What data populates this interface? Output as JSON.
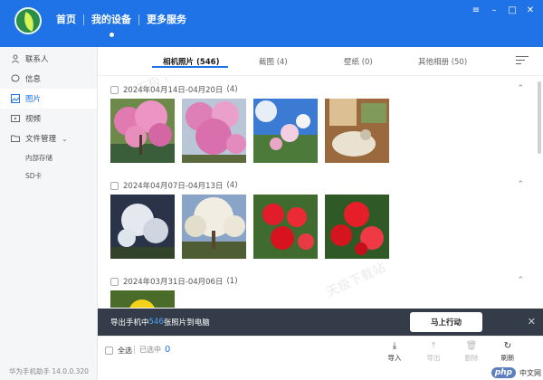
{
  "header": {
    "nav": [
      "首页",
      "我的设备",
      "更多服务"
    ],
    "window_controls": [
      "≡",
      "–",
      "□",
      "✕"
    ]
  },
  "sidebar": {
    "items": [
      {
        "label": "联系人",
        "icon": "person-icon"
      },
      {
        "label": "信息",
        "icon": "message-icon"
      },
      {
        "label": "图片",
        "icon": "image-icon",
        "active": true
      },
      {
        "label": "视频",
        "icon": "video-icon"
      },
      {
        "label": "文件管理",
        "icon": "folder-icon"
      }
    ],
    "sub_items": [
      "内部存储",
      "SD卡"
    ],
    "version": "华为手机助手 14.0.0.320"
  },
  "tabs": [
    {
      "label": "相机照片 (546)",
      "active": true
    },
    {
      "label": "截图 (4)"
    },
    {
      "label": "壁纸 (0)"
    },
    {
      "label": "其他相册 (50)"
    }
  ],
  "groups": [
    {
      "date": "2024年04月14日-04月20日",
      "count": "(4)"
    },
    {
      "date": "2024年04月07日-04月13日",
      "count": "(4)"
    },
    {
      "date": "2024年03月31日-04月06日",
      "count": "(1)"
    }
  ],
  "watermarks": [
    "天极下载站",
    "天极下载站"
  ],
  "banner": {
    "text_before": "导出手机中",
    "count": "546",
    "text_after": "张照片到电脑",
    "button": "马上行动"
  },
  "bottom": {
    "select_all": "全选",
    "selected_label": "已选中",
    "selected_count": "0",
    "tools": [
      "导入",
      "导出",
      "删除",
      "刷新"
    ],
    "badge_php": "php",
    "badge_site": "中文网"
  },
  "colors": {
    "accent": "#1f73e6",
    "banner_bg": "#333c48",
    "highlight": "#4da3ff"
  }
}
